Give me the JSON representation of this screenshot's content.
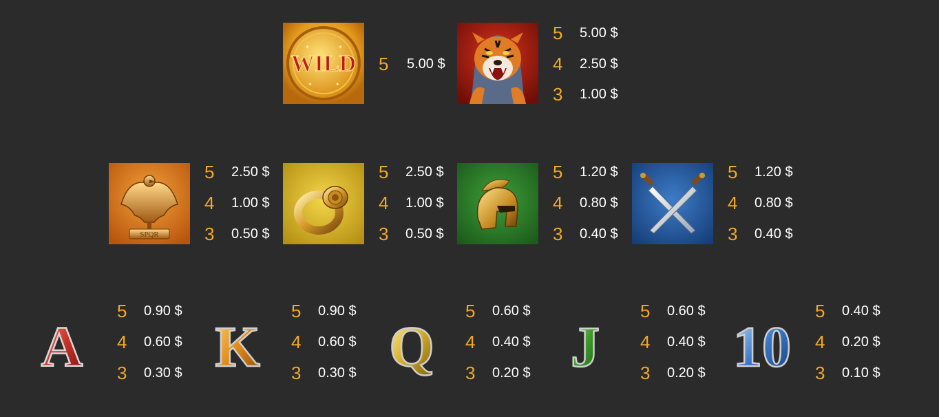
{
  "colors": {
    "background": "#2b2b2b",
    "count": "#f0a92c",
    "value": "#ffffff"
  },
  "symbols": {
    "wild": {
      "icon": "wild-coin-icon",
      "label": "WILD",
      "pays": [
        {
          "count": "5",
          "value": "5.00 $"
        }
      ]
    },
    "tiger": {
      "icon": "tiger-icon",
      "pays": [
        {
          "count": "5",
          "value": "5.00 $"
        },
        {
          "count": "4",
          "value": "2.50 $"
        },
        {
          "count": "3",
          "value": "1.00 $"
        }
      ]
    },
    "eagle": {
      "icon": "eagle-standard-icon",
      "banner": "SPQR",
      "pays": [
        {
          "count": "5",
          "value": "2.50 $"
        },
        {
          "count": "4",
          "value": "1.00 $"
        },
        {
          "count": "3",
          "value": "0.50 $"
        }
      ]
    },
    "ring": {
      "icon": "ring-icon",
      "pays": [
        {
          "count": "5",
          "value": "2.50 $"
        },
        {
          "count": "4",
          "value": "1.00 $"
        },
        {
          "count": "3",
          "value": "0.50 $"
        }
      ]
    },
    "helmet": {
      "icon": "helmet-icon",
      "pays": [
        {
          "count": "5",
          "value": "1.20 $"
        },
        {
          "count": "4",
          "value": "0.80 $"
        },
        {
          "count": "3",
          "value": "0.40 $"
        }
      ]
    },
    "swords": {
      "icon": "crossed-swords-icon",
      "pays": [
        {
          "count": "5",
          "value": "1.20 $"
        },
        {
          "count": "4",
          "value": "0.80 $"
        },
        {
          "count": "3",
          "value": "0.40 $"
        }
      ]
    },
    "a": {
      "glyph": "A",
      "icon": "letter-a-icon",
      "pays": [
        {
          "count": "5",
          "value": "0.90 $"
        },
        {
          "count": "4",
          "value": "0.60 $"
        },
        {
          "count": "3",
          "value": "0.30 $"
        }
      ]
    },
    "k": {
      "glyph": "K",
      "icon": "letter-k-icon",
      "pays": [
        {
          "count": "5",
          "value": "0.90 $"
        },
        {
          "count": "4",
          "value": "0.60 $"
        },
        {
          "count": "3",
          "value": "0.30 $"
        }
      ]
    },
    "q": {
      "glyph": "Q",
      "icon": "letter-q-icon",
      "pays": [
        {
          "count": "5",
          "value": "0.60 $"
        },
        {
          "count": "4",
          "value": "0.40 $"
        },
        {
          "count": "3",
          "value": "0.20 $"
        }
      ]
    },
    "j": {
      "glyph": "J",
      "icon": "letter-j-icon",
      "pays": [
        {
          "count": "5",
          "value": "0.60 $"
        },
        {
          "count": "4",
          "value": "0.40 $"
        },
        {
          "count": "3",
          "value": "0.20 $"
        }
      ]
    },
    "ten": {
      "glyph": "10",
      "icon": "number-10-icon",
      "pays": [
        {
          "count": "5",
          "value": "0.40 $"
        },
        {
          "count": "4",
          "value": "0.20 $"
        },
        {
          "count": "3",
          "value": "0.10 $"
        }
      ]
    }
  }
}
